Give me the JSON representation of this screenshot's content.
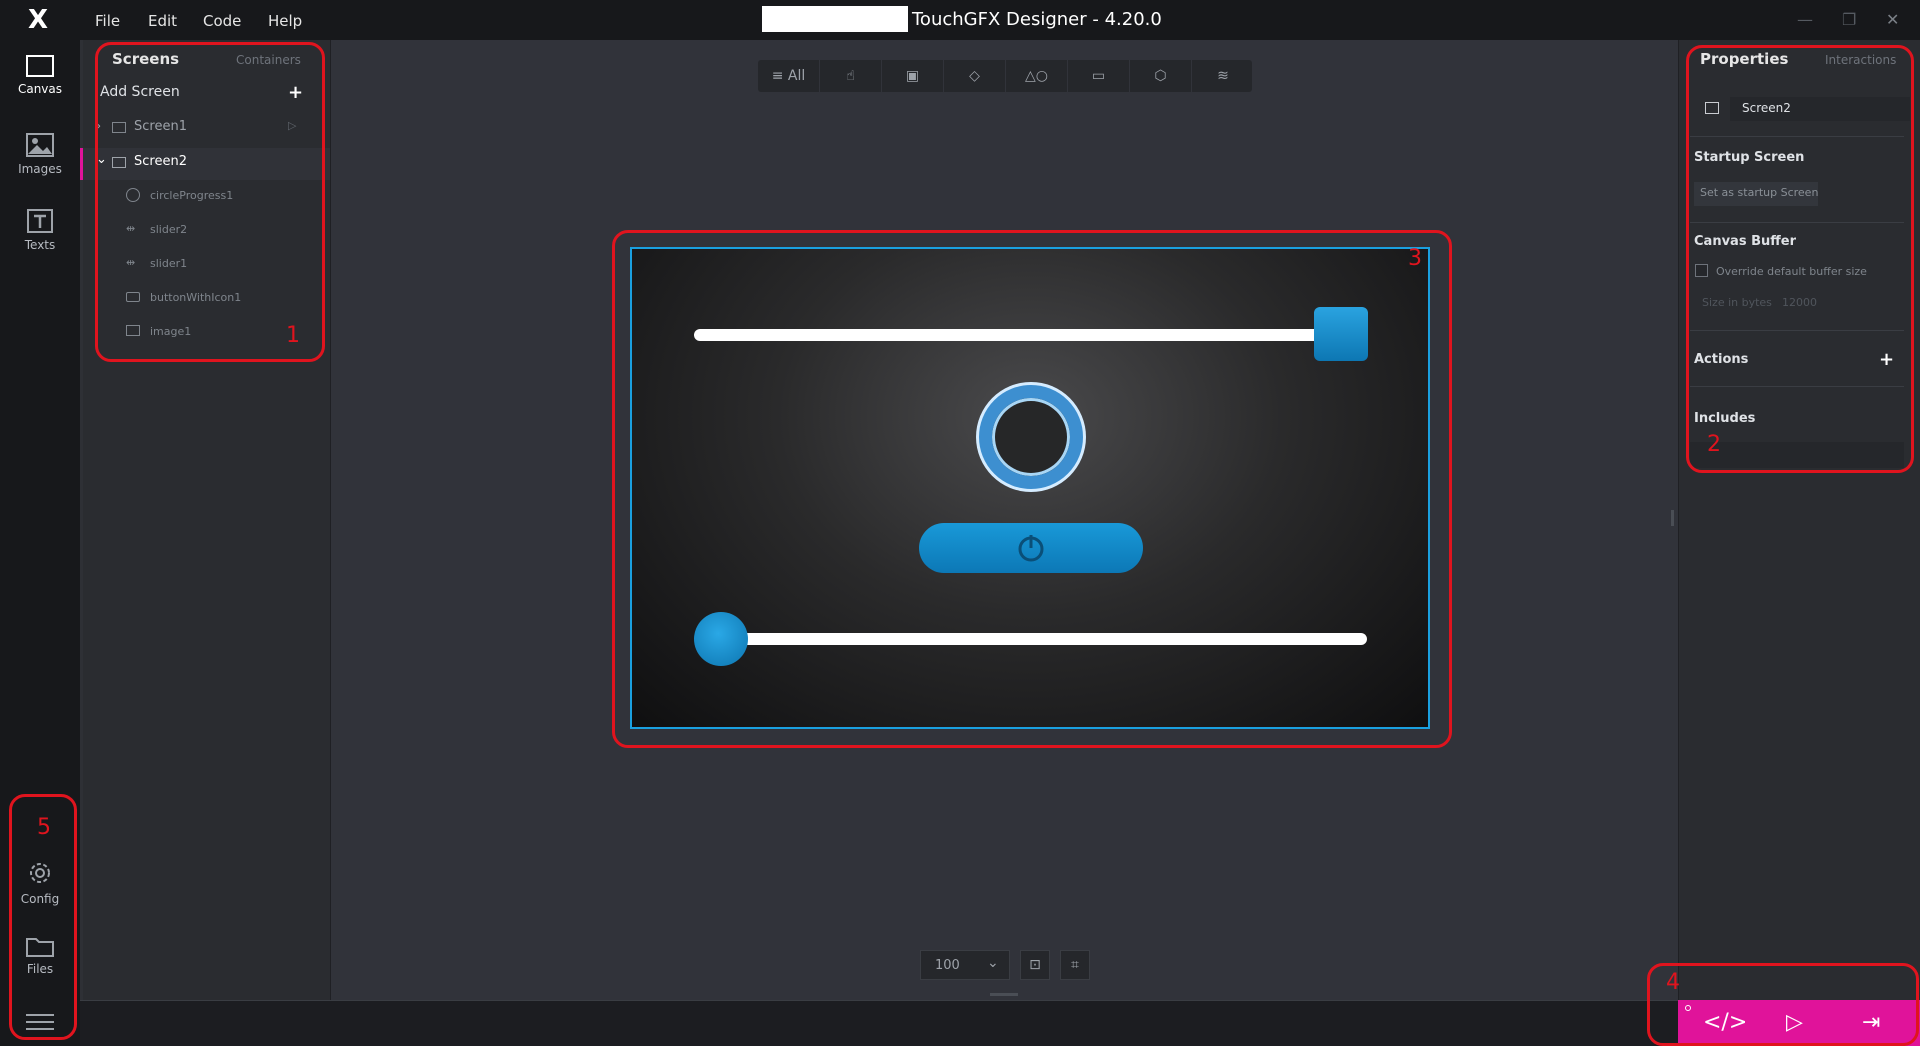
{
  "titlebar": {
    "title": "TouchGFX Designer - 4.20.0",
    "menu": [
      "File",
      "Edit",
      "Code",
      "Help"
    ]
  },
  "rail": {
    "canvas": "Canvas",
    "images": "Images",
    "texts": "Texts",
    "config": "Config",
    "files": "Files"
  },
  "screens_panel": {
    "tab_screens": "Screens",
    "tab_containers": "Containers",
    "add_screen": "Add Screen",
    "screens": [
      {
        "name": "Screen1"
      },
      {
        "name": "Screen2"
      }
    ],
    "widgets": [
      "circleProgress1",
      "slider2",
      "slider1",
      "buttonWithIcon1",
      "image1"
    ]
  },
  "toolbar": {
    "all_label": "All",
    "icons": [
      "interaction-icon",
      "image-icon",
      "layers-icon",
      "shapes-icon",
      "keyboard-icon",
      "cube-icon",
      "stack-icon"
    ]
  },
  "canvas": {
    "zoom": "100",
    "slider2_value": 1.0,
    "slider1_value": 0.0
  },
  "properties": {
    "tab_properties": "Properties",
    "tab_interactions": "Interactions",
    "screen_name": "Screen2",
    "startup_heading": "Startup Screen",
    "startup_button": "Set as startup Screen",
    "buffer_heading": "Canvas Buffer",
    "override_label": "Override default buffer size",
    "size_label": "Size in bytes",
    "size_value": "12000",
    "actions_heading": "Actions",
    "includes_heading": "Includes"
  },
  "annotations": [
    "1",
    "2",
    "3",
    "4",
    "5"
  ],
  "colors": {
    "accent": "#e0139a",
    "widget_blue": "#1aa0e0",
    "annotation_red": "#e0141e"
  }
}
